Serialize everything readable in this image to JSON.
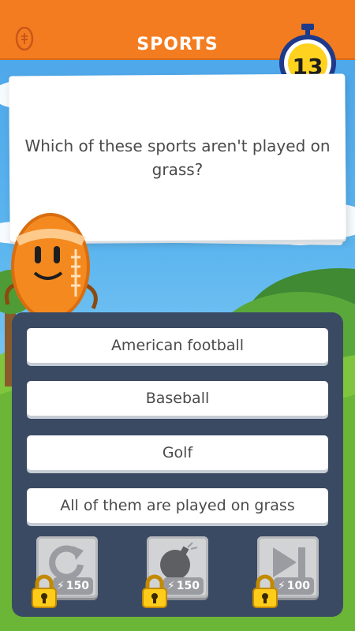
{
  "header": {
    "category_title": "SPORTS",
    "category_icon": "football-icon",
    "timer_value": "13",
    "bar_color": "#f47c20"
  },
  "question": {
    "text": "Which of these sports aren't played on grass?"
  },
  "answers": [
    {
      "label": "American football"
    },
    {
      "label": "Baseball"
    },
    {
      "label": "Golf"
    },
    {
      "label": "All of them are played on grass"
    }
  ],
  "powerups": [
    {
      "icon": "retry-icon",
      "cost": "150",
      "locked": true
    },
    {
      "icon": "bomb-icon",
      "cost": "150",
      "locked": true
    },
    {
      "icon": "skip-icon",
      "cost": "100",
      "locked": true
    }
  ],
  "colors": {
    "panel": "#3a4a63",
    "sky": "#5db6ef",
    "grass": "#7fc63e"
  }
}
